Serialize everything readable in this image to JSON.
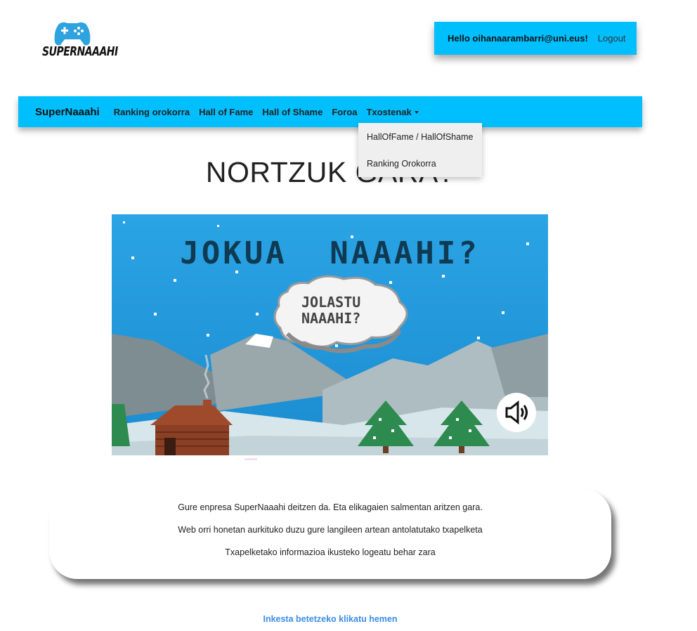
{
  "logo": {
    "text": "SUPERNAAAHI",
    "icon": "gamepad-icon",
    "color": "#2ea3e0"
  },
  "user": {
    "greeting": "Hello oihanaarambarri@uni.eus!",
    "logout_label": "Logout"
  },
  "navbar": {
    "brand": "SuperNaaahi",
    "items": [
      {
        "label": "Ranking orokorra"
      },
      {
        "label": "Hall of Fame"
      },
      {
        "label": "Hall of Shame"
      },
      {
        "label": "Foroa"
      }
    ],
    "dropdown_label": "Txostenak",
    "dropdown_items": [
      {
        "label": "HallOfFame / HallOfShame"
      },
      {
        "label": "Ranking Orokorra"
      }
    ],
    "color": "#00bfff"
  },
  "main": {
    "title": "NORTZUK GARA?",
    "game": {
      "headline": "JOKUA NAAAHI?",
      "cloud_text": [
        "JOLASTU",
        "NAAAHI?"
      ],
      "sound_icon": "speaker-icon"
    },
    "card": {
      "lines": [
        "Gure enpresa SuperNaaahi deitzen da. Eta elikagaien salmentan aritzen gara.",
        "Web orri honetan aurkituko duzu gure langileen artean antolatutako txapelketa",
        "Txapelketako informazioa ikusteko logeatu behar zara"
      ]
    },
    "survey_link": "Inkesta betetzeko klikatu hemen"
  }
}
